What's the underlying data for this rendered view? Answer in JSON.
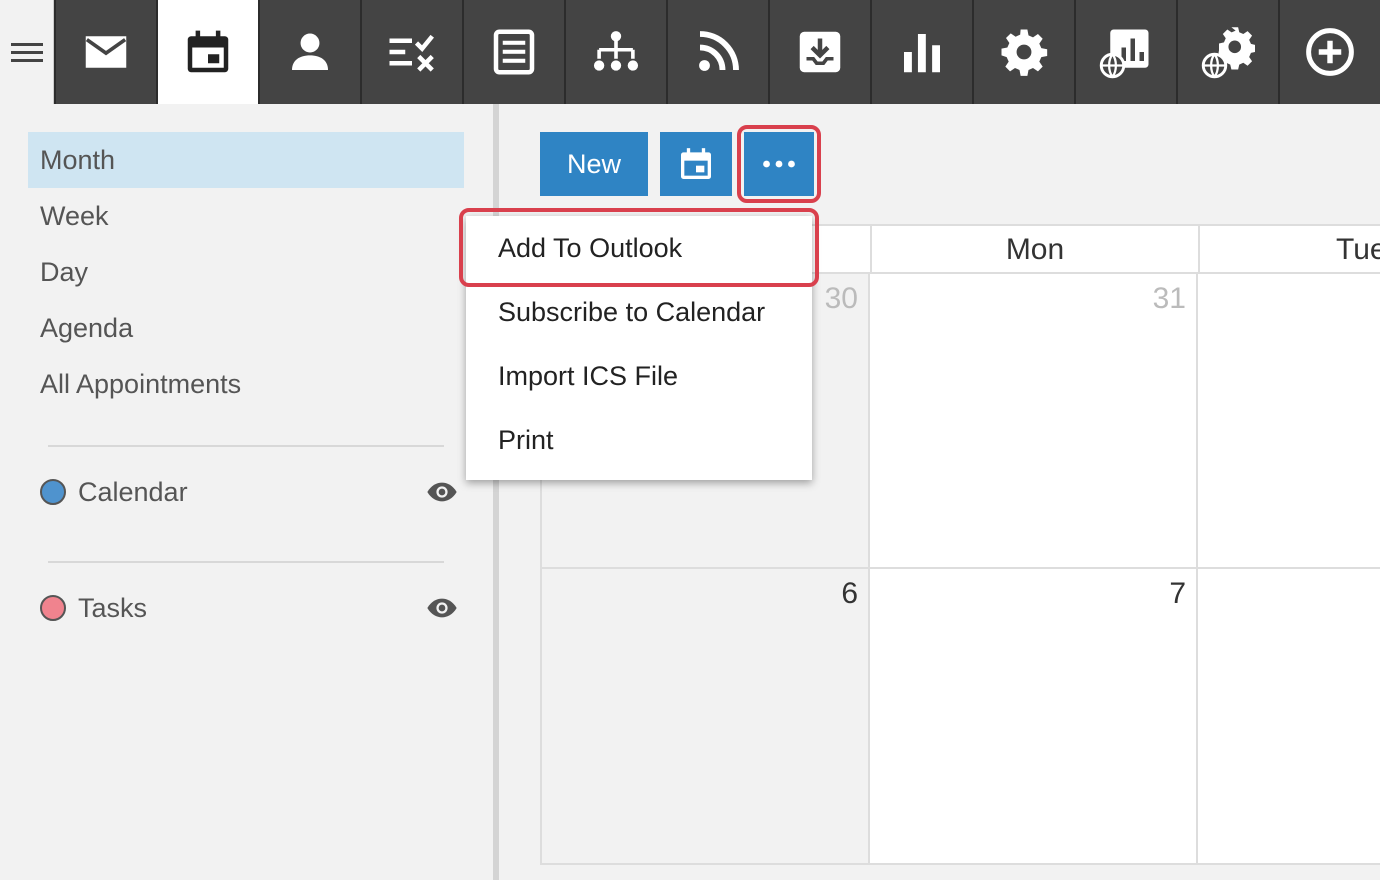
{
  "toolbar": {
    "tabs": [
      {
        "icon": "mail-icon"
      },
      {
        "icon": "calendar-icon"
      },
      {
        "icon": "contacts-icon"
      },
      {
        "icon": "tasks-icon"
      },
      {
        "icon": "notes-icon"
      },
      {
        "icon": "org-chart-icon"
      },
      {
        "icon": "rss-icon"
      },
      {
        "icon": "inbox-download-icon"
      },
      {
        "icon": "bar-chart-icon"
      },
      {
        "icon": "settings-icon"
      },
      {
        "icon": "web-report-icon"
      },
      {
        "icon": "web-settings-icon"
      },
      {
        "icon": "add-circle-icon"
      }
    ],
    "active_tab": "calendar-icon"
  },
  "sidebar": {
    "views": [
      "Month",
      "Week",
      "Day",
      "Agenda",
      "All Appointments"
    ],
    "active_view": "Month",
    "calendars": [
      {
        "label": "Calendar",
        "color": "#4f93ce"
      },
      {
        "label": "Tasks",
        "color": "#f0838e"
      }
    ]
  },
  "actions": {
    "new_label": "New",
    "calendar_button_icon": "calendar-icon",
    "more_button_icon": "more-horizontal-icon"
  },
  "dropdown": {
    "items": [
      "Add To Outlook",
      "Subscribe to Calendar",
      "Import ICS File",
      "Print"
    ],
    "highlighted": "Add To Outlook"
  },
  "calendar": {
    "headers": [
      "Mon",
      "Tue"
    ],
    "rows": [
      {
        "days": [
          "30",
          "31",
          ""
        ]
      },
      {
        "days": [
          "6",
          "7",
          ""
        ]
      }
    ]
  },
  "colors": {
    "accent": "#2f84c4",
    "highlight": "#d9404d",
    "toolbar": "#444444",
    "selected_view": "#cfe5f2"
  }
}
